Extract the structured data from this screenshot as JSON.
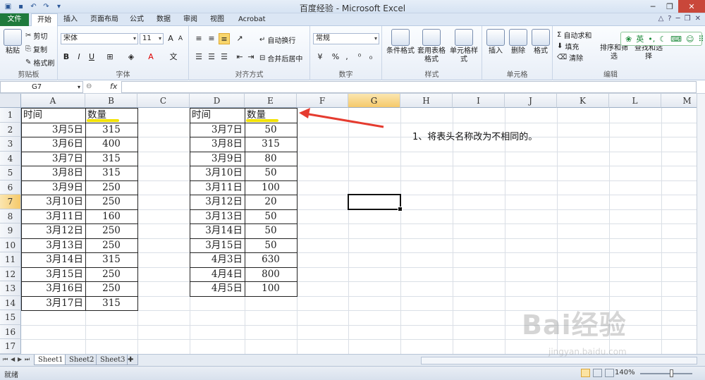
{
  "window": {
    "title": "百度经验 - Microsoft Excel"
  },
  "ribbon_tabs": [
    "文件",
    "开始",
    "插入",
    "页面布局",
    "公式",
    "数据",
    "审阅",
    "视图",
    "Acrobat"
  ],
  "ribbon": {
    "clipboard": {
      "paste": "粘贴",
      "cut": "剪切",
      "copy": "复制",
      "format_painter": "格式刷",
      "label": "剪贴板"
    },
    "font": {
      "name": "宋体",
      "size": "11",
      "label": "字体"
    },
    "alignment": {
      "wrap": "自动换行",
      "merge": "合并后居中",
      "label": "对齐方式"
    },
    "number": {
      "format": "常规",
      "percent": "%",
      "comma": ",",
      "label": "数字"
    },
    "styles": {
      "conditional": "条件格式",
      "table": "套用表格格式",
      "cell_styles": "单元格样式",
      "label": "样式"
    },
    "cells": {
      "insert": "插入",
      "delete": "删除",
      "format": "格式",
      "label": "单元格"
    },
    "editing": {
      "autosum": "自动求和",
      "fill": "填充",
      "clear": "清除",
      "sort": "排序和筛选",
      "find": "查找和选择",
      "label": "编辑"
    },
    "ime": {
      "lang": "英"
    }
  },
  "formula_bar": {
    "name_box": "G7",
    "fx": "fx",
    "content": ""
  },
  "columns": [
    "A",
    "B",
    "C",
    "D",
    "E",
    "F",
    "G",
    "H",
    "I",
    "J",
    "K",
    "L",
    "M"
  ],
  "rows": [
    "1",
    "2",
    "3",
    "4",
    "5",
    "6",
    "7",
    "8",
    "9",
    "10",
    "11",
    "12",
    "13",
    "14",
    "15",
    "16",
    "17"
  ],
  "table1": {
    "header": [
      "时间",
      "数量"
    ],
    "rows": [
      [
        "3月5日",
        "315"
      ],
      [
        "3月6日",
        "400"
      ],
      [
        "3月7日",
        "315"
      ],
      [
        "3月8日",
        "315"
      ],
      [
        "3月9日",
        "250"
      ],
      [
        "3月10日",
        "250"
      ],
      [
        "3月11日",
        "160"
      ],
      [
        "3月12日",
        "250"
      ],
      [
        "3月13日",
        "250"
      ],
      [
        "3月14日",
        "315"
      ],
      [
        "3月15日",
        "250"
      ],
      [
        "3月16日",
        "250"
      ],
      [
        "3月17日",
        "315"
      ]
    ]
  },
  "table2": {
    "header": [
      "时间",
      "数量"
    ],
    "rows": [
      [
        "3月7日",
        "50"
      ],
      [
        "3月8日",
        "315"
      ],
      [
        "3月9日",
        "80"
      ],
      [
        "3月10日",
        "50"
      ],
      [
        "3月11日",
        "100"
      ],
      [
        "3月12日",
        "20"
      ],
      [
        "3月13日",
        "50"
      ],
      [
        "3月14日",
        "50"
      ],
      [
        "3月15日",
        "50"
      ],
      [
        "4月3日",
        "630"
      ],
      [
        "4月4日",
        "800"
      ],
      [
        "4月5日",
        "100"
      ]
    ]
  },
  "annotation": {
    "text": "1、将表头名称改为不相同的。"
  },
  "sheets": [
    "Sheet1",
    "Sheet2",
    "Sheet3"
  ],
  "active_sheet": "Sheet1",
  "status": {
    "ready": "就绪",
    "zoom": "140%"
  },
  "watermark": {
    "brand": "Bai经验",
    "url": "jingyan.baidu.com"
  },
  "colors": {
    "file_tab": "#1f7a3c",
    "highlight": "#f2e200",
    "arrow": "#e53b2f",
    "selected_header": "#f5c96a"
  }
}
